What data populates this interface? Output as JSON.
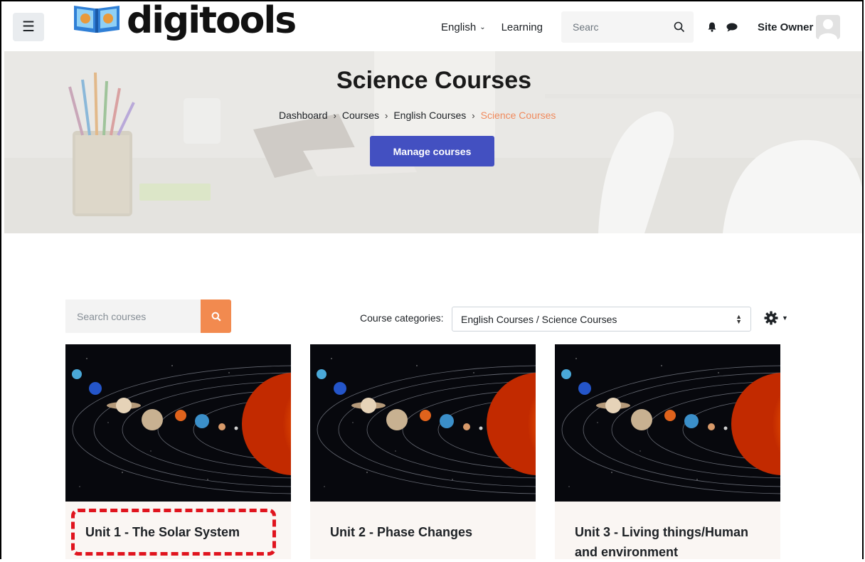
{
  "navbar": {
    "menu_icon": "hamburger-icon",
    "logo_text": "digitools",
    "language": "English",
    "learning": "Learning",
    "search_placeholder": "Searc",
    "user_name": "Site Owner",
    "icons": [
      "search-icon",
      "bell-icon",
      "chat-icon",
      "avatar"
    ]
  },
  "hero": {
    "title": "Science Courses",
    "breadcrumb": [
      "Dashboard",
      "Courses",
      "English Courses",
      "Science Courses"
    ],
    "manage_button": "Manage courses"
  },
  "filters": {
    "search_placeholder": "Search courses",
    "category_label": "Course categories:",
    "category_value": "English Courses / Science Courses"
  },
  "courses": [
    {
      "title": "Unit 1 - The Solar System"
    },
    {
      "title": "Unit 2 - Phase Changes"
    },
    {
      "title": "Unit 3 - Living things/Human and environment"
    }
  ],
  "colors": {
    "accent_orange": "#f28a4f",
    "button_blue": "#4350c1",
    "breadcrumb_active": "#f08a5d",
    "highlight_red": "#e0141e"
  }
}
